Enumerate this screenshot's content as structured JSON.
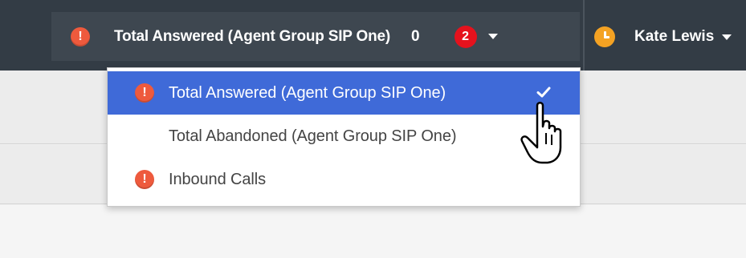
{
  "topbar": {
    "kpi_title": "Total Answered (Agent Group SIP One)",
    "kpi_value": "0",
    "alert_count": "2",
    "user_name": "Kate Lewis"
  },
  "dropdown": {
    "items": [
      {
        "label": "Total Answered (Agent Group SIP One)",
        "alert": true,
        "selected": true
      },
      {
        "label": "Total Abandoned (Agent Group SIP One)",
        "alert": false,
        "selected": false
      },
      {
        "label": "Inbound Calls",
        "alert": true,
        "selected": false
      }
    ]
  },
  "icons": {
    "alert": "!",
    "alert_icon": "exclamation-circle-icon",
    "status_icon": "clock-icon",
    "selected_icon": "checkmark-icon",
    "cursor": "hand-pointer-cursor"
  },
  "colors": {
    "topbar": "#333c45",
    "kpi_button": "#3e4750",
    "alert": "#ee5a3d",
    "badge": "#e5121d",
    "status_away": "#f4a223",
    "selected": "#3f6ad8"
  }
}
